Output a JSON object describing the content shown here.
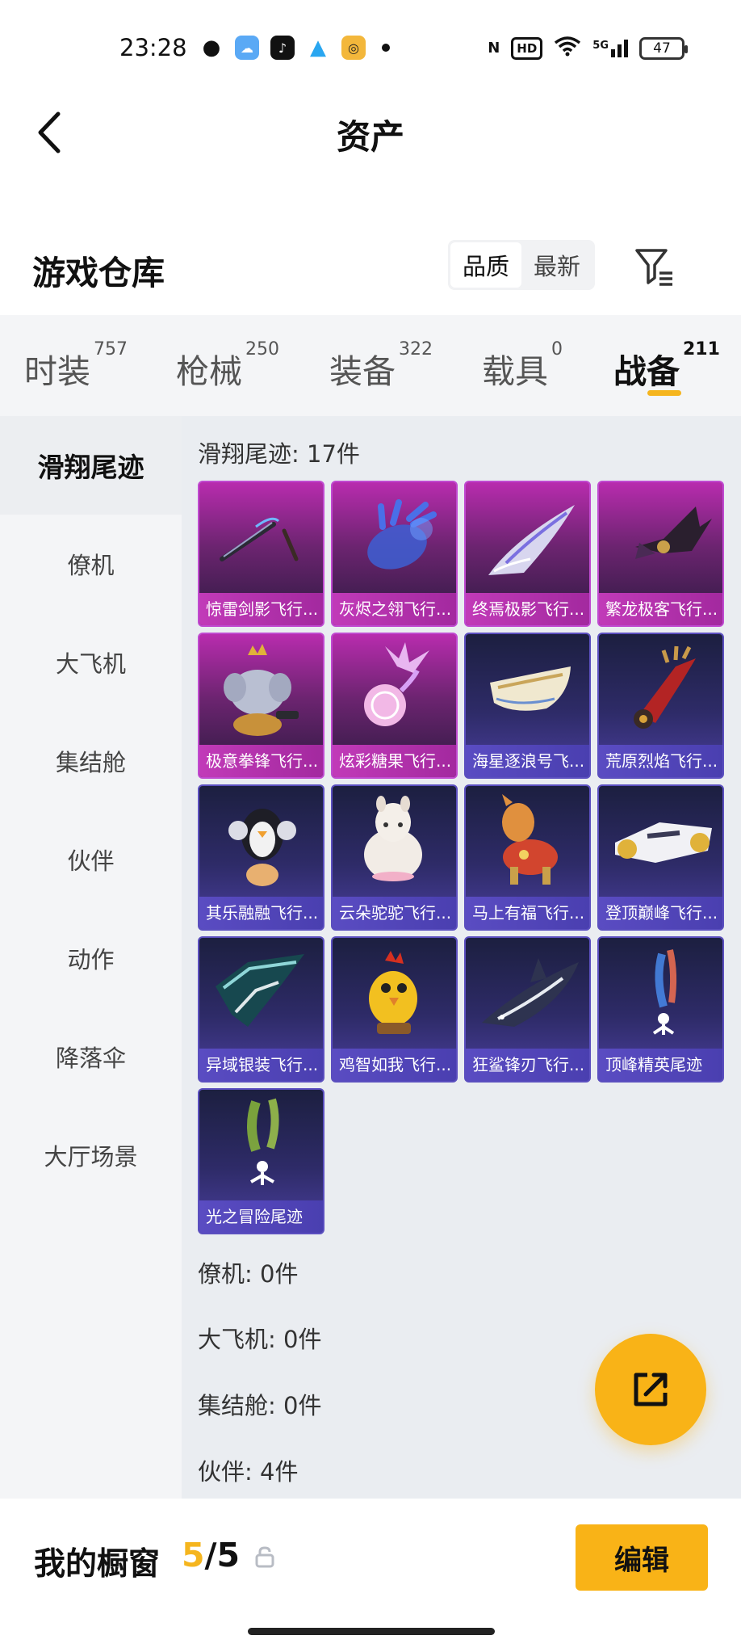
{
  "status_bar": {
    "time": "23:28",
    "signal_label": "5G",
    "hd_label": "HD",
    "battery": "47",
    "app_icons": [
      "wechat-icon",
      "weather-icon",
      "tiktok-icon",
      "qq-icon",
      "game-icon"
    ]
  },
  "header": {
    "title": "资产"
  },
  "warehouse": {
    "title": "游戏仓库",
    "sort_options": [
      "品质",
      "最新"
    ],
    "sort_selected": "品质"
  },
  "category_tabs": [
    {
      "label": "时装",
      "count": "757"
    },
    {
      "label": "枪械",
      "count": "250"
    },
    {
      "label": "装备",
      "count": "322"
    },
    {
      "label": "载具",
      "count": "0"
    },
    {
      "label": "战备",
      "count": "211"
    }
  ],
  "category_selected": "战备",
  "side_nav": [
    "滑翔尾迹",
    "僚机",
    "大飞机",
    "集结舱",
    "伙伴",
    "动作",
    "降落伞",
    "大厅场景"
  ],
  "side_nav_selected": "滑翔尾迹",
  "sections": [
    {
      "label": "滑翔尾迹: 17件"
    },
    {
      "label": "僚机: 0件"
    },
    {
      "label": "大飞机: 0件"
    },
    {
      "label": "集结舱: 0件"
    },
    {
      "label": "伙伴: 4件"
    }
  ],
  "items": [
    {
      "name": "惊雷剑影飞行...",
      "rarity": "purple",
      "icon": "sword-wing-icon"
    },
    {
      "name": "灰烬之翎飞行...",
      "rarity": "purple",
      "icon": "glove-icon"
    },
    {
      "name": "终焉极影飞行...",
      "rarity": "purple",
      "icon": "jet-icon"
    },
    {
      "name": "繁龙极客飞行...",
      "rarity": "purple",
      "icon": "bat-wing-icon"
    },
    {
      "name": "极意拳锋飞行...",
      "rarity": "purple",
      "icon": "elephant-icon"
    },
    {
      "name": "炫彩糖果飞行...",
      "rarity": "purple",
      "icon": "candy-icon"
    },
    {
      "name": "海星逐浪号飞...",
      "rarity": "blue",
      "icon": "boat-icon"
    },
    {
      "name": "荒原烈焰飞行...",
      "rarity": "blue",
      "icon": "flame-craft-icon"
    },
    {
      "name": "其乐融融飞行...",
      "rarity": "blue",
      "icon": "penguin-icon"
    },
    {
      "name": "云朵驼驼飞行...",
      "rarity": "blue",
      "icon": "alpaca-icon"
    },
    {
      "name": "马上有福飞行...",
      "rarity": "blue",
      "icon": "horse-icon"
    },
    {
      "name": "登顶巅峰飞行...",
      "rarity": "blue",
      "icon": "spaceship-icon"
    },
    {
      "name": "异域银装飞行...",
      "rarity": "blue",
      "icon": "wing-glider-icon"
    },
    {
      "name": "鸡智如我飞行...",
      "rarity": "blue",
      "icon": "chicken-icon"
    },
    {
      "name": "狂鲨锋刃飞行...",
      "rarity": "blue",
      "icon": "shark-icon"
    },
    {
      "name": "顶峰精英尾迹",
      "rarity": "blue",
      "icon": "trail-icon"
    },
    {
      "name": "光之冒险尾迹",
      "rarity": "blue",
      "icon": "green-trail-icon"
    }
  ],
  "showcase": {
    "title": "我的橱窗",
    "current": "5",
    "separator": "/",
    "total": "5"
  },
  "edit_button": "编辑",
  "colors": {
    "accent": "#f9b317",
    "purple_rarity": "#b82cae",
    "blue_rarity": "#4a3fb0"
  }
}
